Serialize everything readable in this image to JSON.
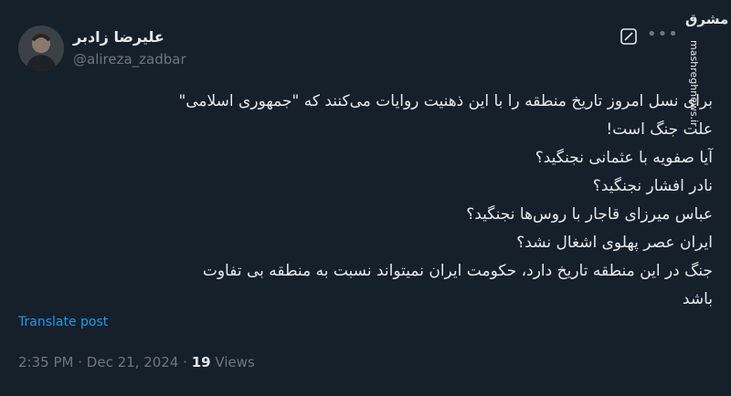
{
  "author": {
    "display_name": "علیرضا زادبر",
    "handle": "@alireza_zadbar"
  },
  "watermark": {
    "logo_text": "مشرق",
    "site": "mashreghnews.ir"
  },
  "post": {
    "lines": [
      "برای نسل امروز تاریخ منطقه را با این ذهنیت روایات می‌کنند که \"جمهوری اسلامی\"",
      "علت جنگ است!",
      "آیا صفویه با عثمانی نجنگید؟",
      "نادر افشار نجنگید؟",
      "عباس میرزای قاجار با روس‌ها نجنگید؟",
      "ایران عصر پهلوی اشغال نشد؟",
      "جنگ در این منطقه تاریخ دارد، حکومت ایران نمیتواند نسبت به منطقه بی تفاوت",
      "باشد"
    ],
    "translate_label": "Translate post",
    "time": "2:35 PM",
    "separator": "·",
    "date": "Dec 21, 2024",
    "views_count": "19",
    "views_label": "Views"
  },
  "icons": {
    "grok": "grok-icon",
    "more": "more-icon",
    "avatar": "avatar"
  },
  "colors": {
    "background": "#15202b",
    "text": "#e7e9ea",
    "secondary": "#71767b",
    "link": "#1d9bf0"
  }
}
